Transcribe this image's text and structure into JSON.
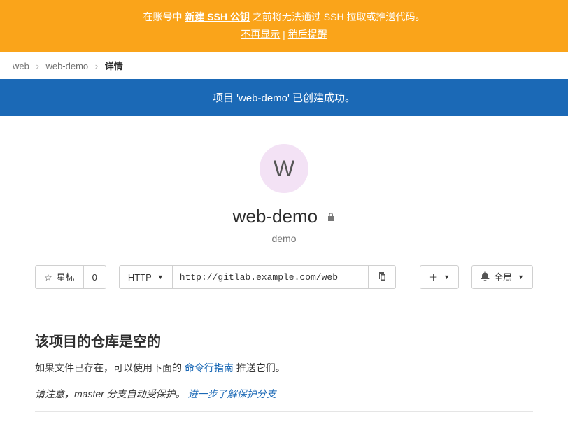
{
  "sshBanner": {
    "prefix": "在账号中",
    "createLink": "新建 SSH 公钥",
    "suffix": "之前将无法通过 SSH 拉取或推送代码。",
    "dontShow": "不再显示",
    "sep": " | ",
    "remindLater": "稍后提醒"
  },
  "breadcrumb": {
    "item1": "web",
    "item2": "web-demo",
    "item3": "详情"
  },
  "flash": "项目 'web-demo' 已创建成功。",
  "project": {
    "avatarLetter": "W",
    "name": "web-demo",
    "description": "demo"
  },
  "actions": {
    "starLabel": "星标",
    "starCount": "0",
    "protocol": "HTTP",
    "url": "http://gitlab.example.com/web",
    "plus": "＋",
    "notifyLabel": "全局"
  },
  "empty": {
    "heading": "该项目的仓库是空的",
    "p1a": "如果文件已存在，可以使用下面的",
    "cliLink": "命令行指南",
    "p1b": "推送它们。",
    "p2a": "请注意，master 分支自动受保护。",
    "p2link": "进一步了解保护分支"
  }
}
